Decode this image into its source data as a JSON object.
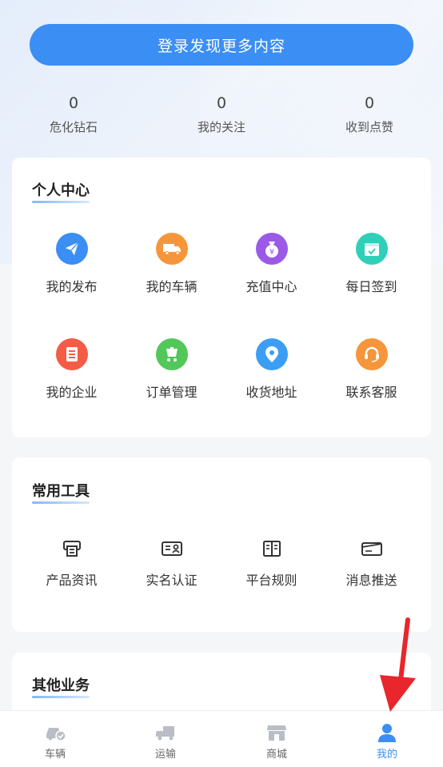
{
  "login": {
    "label": "登录发现更多内容"
  },
  "stats": [
    {
      "value": "0",
      "label": "危化钻石"
    },
    {
      "value": "0",
      "label": "我的关注"
    },
    {
      "value": "0",
      "label": "收到点赞"
    }
  ],
  "personal_center": {
    "title": "个人中心",
    "items": [
      {
        "label": "我的发布",
        "icon": "paper-plane-icon",
        "color": "#3b8ef3"
      },
      {
        "label": "我的车辆",
        "icon": "truck-icon",
        "color": "#f7953a"
      },
      {
        "label": "充值中心",
        "icon": "money-bag-icon",
        "color": "#9b59e8"
      },
      {
        "label": "每日签到",
        "icon": "calendar-check-icon",
        "color": "#2fcfb8"
      },
      {
        "label": "我的企业",
        "icon": "enterprise-icon",
        "color": "#f45c45"
      },
      {
        "label": "订单管理",
        "icon": "cart-icon",
        "color": "#52c75a"
      },
      {
        "label": "收货地址",
        "icon": "location-pin-icon",
        "color": "#3b9ef3"
      },
      {
        "label": "联系客服",
        "icon": "headset-icon",
        "color": "#f7953a"
      }
    ]
  },
  "tools": {
    "title": "常用工具",
    "items": [
      {
        "label": "产品资讯",
        "icon": "printer-news-icon"
      },
      {
        "label": "实名认证",
        "icon": "id-card-icon"
      },
      {
        "label": "平台规则",
        "icon": "book-icon"
      },
      {
        "label": "消息推送",
        "icon": "envelope-icon"
      }
    ]
  },
  "other": {
    "title": "其他业务"
  },
  "tabbar": {
    "tabs": [
      {
        "label": "车辆",
        "icon": "car-icon"
      },
      {
        "label": "运输",
        "icon": "transport-truck-icon"
      },
      {
        "label": "商城",
        "icon": "store-icon"
      },
      {
        "label": "我的",
        "icon": "user-icon"
      }
    ],
    "active_color": "#3b8ef3"
  }
}
